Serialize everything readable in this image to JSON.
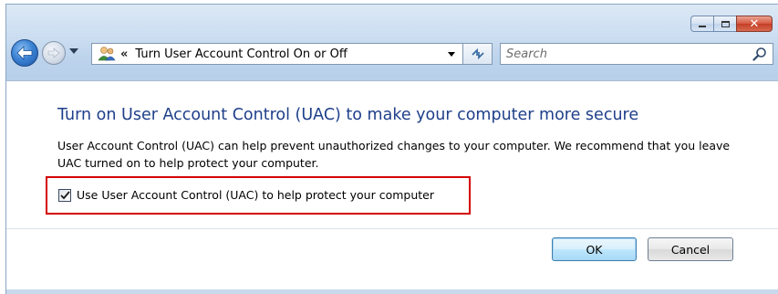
{
  "window": {
    "caption_buttons": {
      "minimize": "minimize-icon",
      "maximize": "maximize-icon",
      "close": "close-icon",
      "close_glyph": "✕"
    }
  },
  "navbar": {
    "back_icon": "back-arrow-icon",
    "forward_icon": "forward-arrow-icon",
    "address": {
      "icon": "user-accounts-icon",
      "breadcrumb_chevron": "«",
      "text": "Turn User Account Control On or Off"
    },
    "refresh_icon": "refresh-icon",
    "search": {
      "placeholder": "Search",
      "value": ""
    }
  },
  "content": {
    "heading": "Turn on User Account Control (UAC) to make your computer more secure",
    "description": "User Account Control (UAC) can help prevent unauthorized changes to your computer.  We recommend that you leave UAC turned on to help protect your computer.",
    "checkbox": {
      "label": "Use User Account Control (UAC) to help protect your computer",
      "checked": true
    },
    "buttons": {
      "ok": "OK",
      "cancel": "Cancel"
    }
  },
  "colors": {
    "heading": "#1e3f8a",
    "highlight_border": "#d40000",
    "window_frame": "#b8d0ea"
  }
}
